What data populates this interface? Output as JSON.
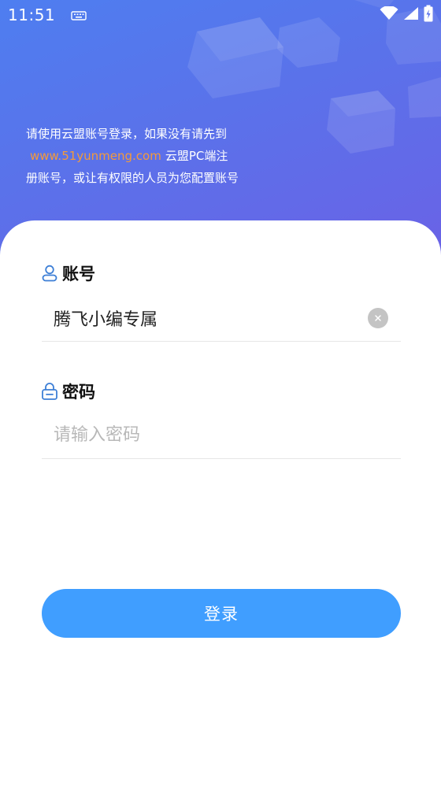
{
  "status_bar": {
    "time": "11:51",
    "icons": [
      "keyboard-icon",
      "wifi-icon",
      "signal-icon",
      "battery-charging-icon"
    ]
  },
  "intro": {
    "line1": "请使用云盟账号登录，如果没有请先到",
    "link": "www.51yunmeng.com",
    "line2_suffix": "云盟PC端注",
    "line3": "册账号，或让有权限的人员为您配置账号"
  },
  "account": {
    "icon": "user-icon",
    "label": "账号",
    "value": "腾飞小编专属",
    "clear_icon": "clear-icon"
  },
  "password": {
    "icon": "lock-icon",
    "label": "密码",
    "placeholder": "请输入密码"
  },
  "login_button": {
    "label": "登录"
  },
  "colors": {
    "header_gradient_start": "#4e7ef0",
    "header_gradient_end": "#6a62e6",
    "link": "#f39a3c",
    "accent_icon": "#3d7fd6",
    "button": "#409eff"
  }
}
